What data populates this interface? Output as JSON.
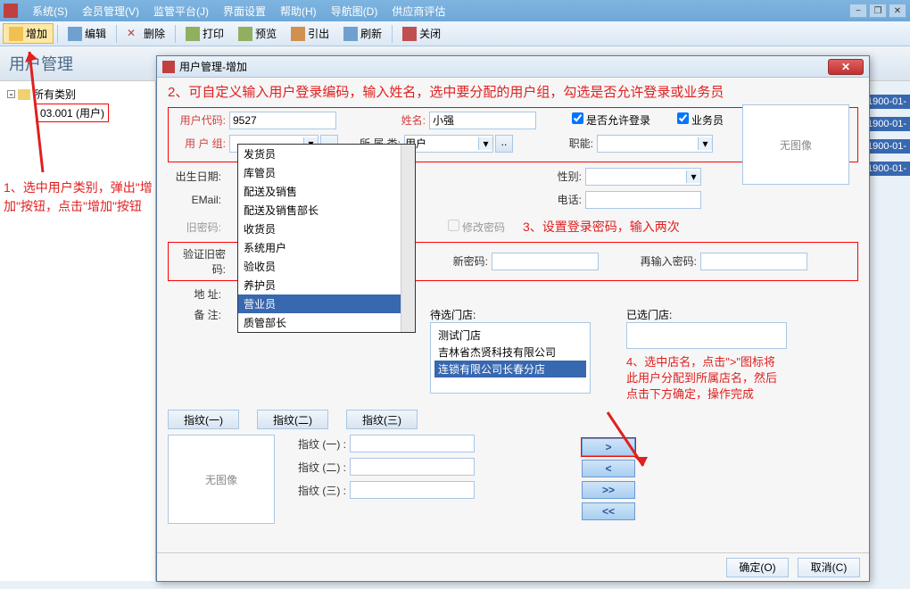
{
  "menubar": {
    "items": [
      "系统(S)",
      "会员管理(V)",
      "监管平台(J)",
      "界面设置",
      "帮助(H)",
      "导航图(D)",
      "供应商评估"
    ],
    "win_min": "−",
    "win_res": "❐",
    "win_close": "✕"
  },
  "toolbar": {
    "add": "增加",
    "edit": "编辑",
    "delete": "删除",
    "print": "打印",
    "preview": "预览",
    "export": "引出",
    "refresh": "刷新",
    "close": "关闭"
  },
  "page_title": "用户管理",
  "tree": {
    "root": "所有类别",
    "child": "03.001 (用户)"
  },
  "annotations": {
    "a1": "1、选中用户类别，弹出\"增加\"按钮，点击\"增加\"按钮",
    "a2": "2、可自定义输入用户登录编码，输入姓名，选中要分配的用户组，勾选是否允许登录或业务员",
    "a3": "3、设置登录密码，输入两次",
    "a4": "4、选中店名，点击\">\"图标将此用户分配到所属店名，然后点击下方确定，操作完成"
  },
  "dialog": {
    "title": "用户管理-增加",
    "labels": {
      "user_code": "用户代码:",
      "name": "姓名:",
      "allow_login": "是否允许登录",
      "is_sales": "业务员",
      "user_group": "用 户 组:",
      "category": "所 属 类:",
      "role": "职能:",
      "birth": "出生日期:",
      "gender": "性别:",
      "email": "EMail:",
      "phone": "电话:",
      "old_pwd": "旧密码:",
      "change_pwd": "修改密码",
      "new_pwd": "新密码:",
      "repeat_pwd": "再输入密码:",
      "verify_pwd": "验证旧密码:",
      "address": "地    址:",
      "remark": "备    注:",
      "pending": "待选门店:",
      "selected": "已选门店:",
      "no_image": "无图像",
      "fp1": "指纹(一)",
      "fp2": "指纹(二)",
      "fp3": "指纹(三)",
      "fpl1": "指纹 (一) :",
      "fpl2": "指纹 (二) :",
      "fpl3": "指纹 (三) :",
      "ok": "确定(O)",
      "cancel": "取消(C)"
    },
    "values": {
      "user_code": "9527",
      "name": "小强",
      "category": "用户"
    },
    "dropdown_items": [
      "发货员",
      "库管员",
      "配送及销售",
      "配送及销售部长",
      "收货员",
      "系统用户",
      "验收员",
      "养护员",
      "营业员",
      "质管部长"
    ],
    "dropdown_selected": "营业员",
    "pending_stores": [
      "测试门店",
      "吉林省杰贤科技有限公司",
      "连锁有限公司长春分店"
    ],
    "pending_selected": "连锁有限公司长春分店",
    "xfer": {
      "r": ">",
      "l": "<",
      "rr": ">>",
      "ll": "<<"
    }
  },
  "right_dates": [
    "1900-01-",
    "1900-01-",
    "1900-01-",
    "1900-01-"
  ]
}
